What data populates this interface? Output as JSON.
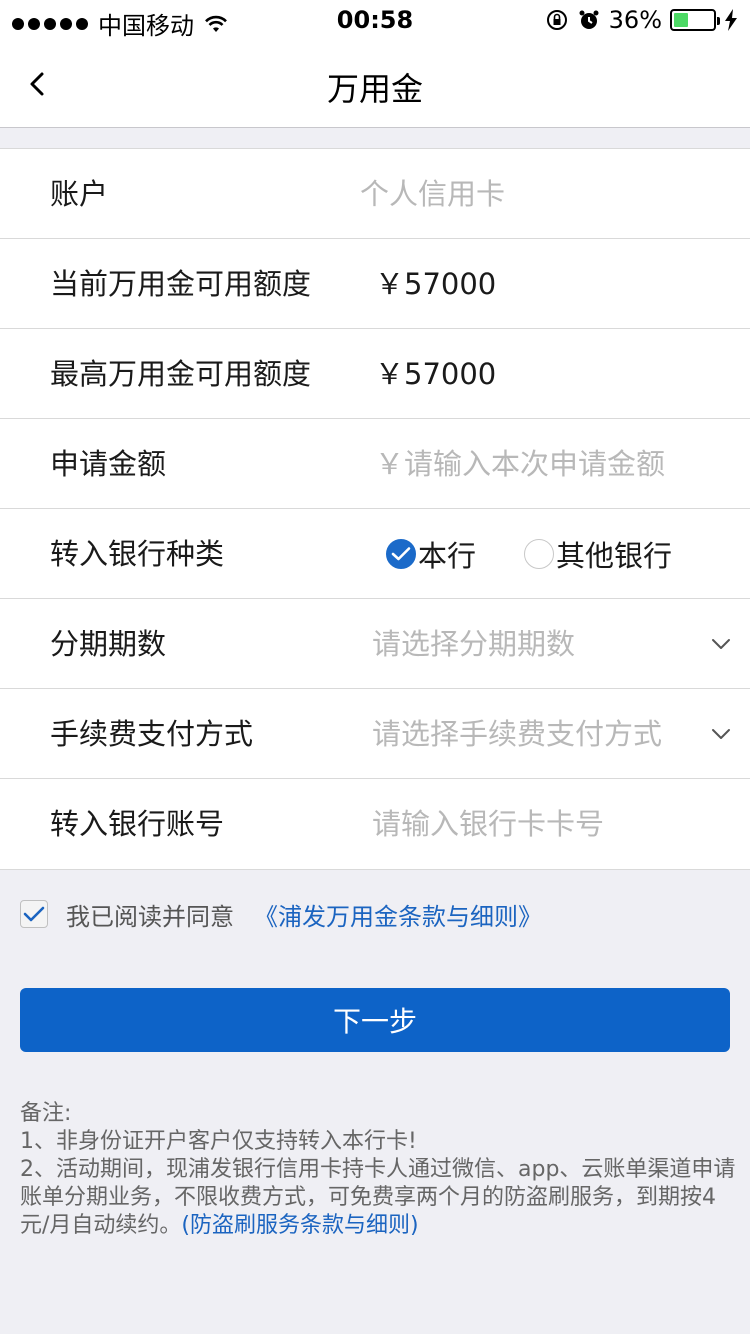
{
  "status_bar": {
    "carrier": "中国移动",
    "time": "00:58",
    "battery_percent": "36%",
    "battery_level": 0.36
  },
  "nav": {
    "title": "万用金",
    "back_icon": "chevron-left-icon"
  },
  "form": {
    "account": {
      "label": "账户",
      "value": "个人信用卡"
    },
    "current_limit": {
      "label": "当前万用金可用额度",
      "value": "￥57000"
    },
    "max_limit": {
      "label": "最高万用金可用额度",
      "value": "￥57000"
    },
    "apply_amount": {
      "label": "申请金额",
      "placeholder": "￥请输入本次申请金额"
    },
    "bank_type": {
      "label": "转入银行种类",
      "options": [
        {
          "label": "本行",
          "selected": true
        },
        {
          "label": "其他银行",
          "selected": false
        }
      ]
    },
    "installments": {
      "label": "分期期数",
      "placeholder": "请选择分期期数"
    },
    "fee_method": {
      "label": "手续费支付方式",
      "placeholder": "请选择手续费支付方式"
    },
    "bank_account": {
      "label": "转入银行账号",
      "placeholder": "请输入银行卡卡号"
    }
  },
  "agreement": {
    "checked": true,
    "text": "我已阅读并同意",
    "link": "《浦发万用金条款与细则》"
  },
  "next_button": "下一步",
  "notes": {
    "title": "备注:",
    "line1": "1、非身份证开户客户仅支持转入本行卡!",
    "line2": "2、活动期间，现浦发银行信用卡持卡人通过微信、app、云账单渠道申请账单分期业务，不限收费方式，可免费享两个月的防盗刷服务，到期按4元/月自动续约。",
    "link": "(防盗刷服务条款与细则)"
  },
  "colors": {
    "primary": "#0d63c8",
    "link": "#1b64c0",
    "background": "#efeff4",
    "placeholder": "#b8b8b8"
  }
}
